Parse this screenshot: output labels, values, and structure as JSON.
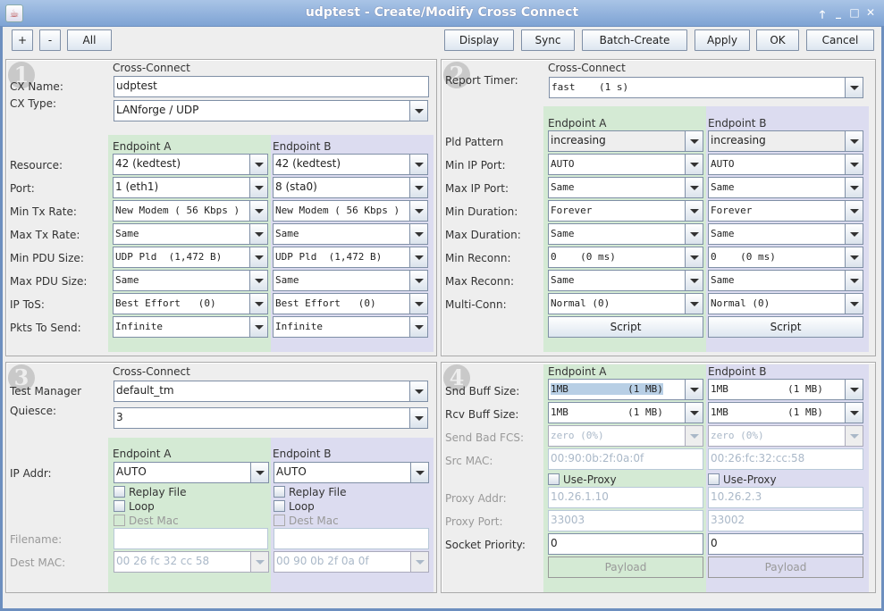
{
  "window": {
    "title": "udptest - Create/Modify Cross Connect",
    "controls": [
      "pin-up",
      "minimize",
      "maximize",
      "close"
    ]
  },
  "toolbar": {
    "plus": "+",
    "minus": "-",
    "all": "All",
    "display": "Display",
    "sync": "Sync",
    "batch_create": "Batch-Create",
    "apply": "Apply",
    "ok": "OK",
    "cancel": "Cancel"
  },
  "headers": {
    "cross_connect": "Cross-Connect",
    "endpoint_a": "Endpoint A",
    "endpoint_b": "Endpoint B"
  },
  "panel1": {
    "badge": "1",
    "cx_name_label": "CX Name:",
    "cx_name": "udptest",
    "cx_type_label": "CX Type:",
    "cx_type": "LANforge / UDP",
    "rows": [
      {
        "label": "Resource:",
        "a": "42 (kedtest)",
        "b": "42 (kedtest)",
        "mono": false
      },
      {
        "label": "Port:",
        "a": "1 (eth1)",
        "b": "8 (sta0)",
        "mono": false
      },
      {
        "label": "Min Tx Rate:",
        "a": "New Modem ( 56 Kbps )",
        "b": "New Modem ( 56 Kbps )",
        "mono": true
      },
      {
        "label": "Max Tx Rate:",
        "a": "Same",
        "b": "Same",
        "mono": true
      },
      {
        "label": "Min PDU Size:",
        "a": "UDP Pld  (1,472 B)",
        "b": "UDP Pld  (1,472 B)",
        "mono": true
      },
      {
        "label": "Max PDU Size:",
        "a": "Same",
        "b": "Same",
        "mono": true
      },
      {
        "label": "IP ToS:",
        "a": "Best Effort   (0)",
        "b": "Best Effort   (0)",
        "mono": true
      },
      {
        "label": "Pkts To Send:",
        "a": "Infinite",
        "b": "Infinite",
        "mono": true
      }
    ]
  },
  "panel2": {
    "badge": "2",
    "report_timer_label": "Report Timer:",
    "report_timer": "fast    (1 s)",
    "rows": [
      {
        "label": "Pld Pattern",
        "a": "increasing",
        "b": "increasing",
        "mono": false
      },
      {
        "label": "Min IP Port:",
        "a": "AUTO",
        "b": "AUTO",
        "mono": true
      },
      {
        "label": "Max IP Port:",
        "a": "Same",
        "b": "Same",
        "mono": true
      },
      {
        "label": "Min Duration:",
        "a": "Forever",
        "b": "Forever",
        "mono": true
      },
      {
        "label": "Max Duration:",
        "a": "Same",
        "b": "Same",
        "mono": true
      },
      {
        "label": "Min Reconn:",
        "a": "0    (0 ms)",
        "b": "0    (0 ms)",
        "mono": true
      },
      {
        "label": "Max Reconn:",
        "a": "Same",
        "b": "Same",
        "mono": true
      },
      {
        "label": "Multi-Conn:",
        "a": "Normal (0)",
        "b": "Normal (0)",
        "mono": true
      }
    ],
    "script_a": "Script",
    "script_b": "Script"
  },
  "panel3": {
    "badge": "3",
    "test_manager_label": "Test Manager",
    "test_manager": "default_tm",
    "quiesce_label": "Quiesce:",
    "quiesce": "3",
    "ip_addr_label": "IP Addr:",
    "ip_addr_a": "AUTO",
    "ip_addr_b": "AUTO",
    "replay_file": "Replay File",
    "loop": "Loop",
    "dest_mac_chk": "Dest Mac",
    "filename_label": "Filename:",
    "filename_a": "",
    "filename_b": "",
    "dest_mac_label": "Dest MAC:",
    "dest_mac_a": "00 26 fc 32 cc 58",
    "dest_mac_b": "00 90 0b 2f 0a 0f"
  },
  "panel4": {
    "badge": "4",
    "snd_buff_label": "Snd Buff Size:",
    "snd_buff_a": "1MB          (1 MB)",
    "snd_buff_b": "1MB          (1 MB)",
    "rcv_buff_label": "Rcv Buff Size:",
    "rcv_buff_a": "1MB          (1 MB)",
    "rcv_buff_b": "1MB          (1 MB)",
    "bad_fcs_label": "Send Bad FCS:",
    "bad_fcs_a": "zero (0%)",
    "bad_fcs_b": "zero (0%)",
    "src_mac_label": "Src MAC:",
    "src_mac_a": "00:90:0b:2f:0a:0f",
    "src_mac_b": "00:26:fc:32:cc:58",
    "use_proxy": "Use-Proxy",
    "proxy_addr_label": "Proxy Addr:",
    "proxy_addr_a": "10.26.1.10",
    "proxy_addr_b": "10.26.2.3",
    "proxy_port_label": "Proxy Port:",
    "proxy_port_a": "33003",
    "proxy_port_b": "33002",
    "socket_priority_label": "Socket Priority:",
    "socket_priority_a": "0",
    "socket_priority_b": "0",
    "payload_a": "Payload",
    "payload_b": "Payload"
  },
  "colors": {
    "endpoint_a_bg": "#d4ead4",
    "endpoint_b_bg": "#dcdcf0",
    "titlebar": "#7ea3d4"
  }
}
